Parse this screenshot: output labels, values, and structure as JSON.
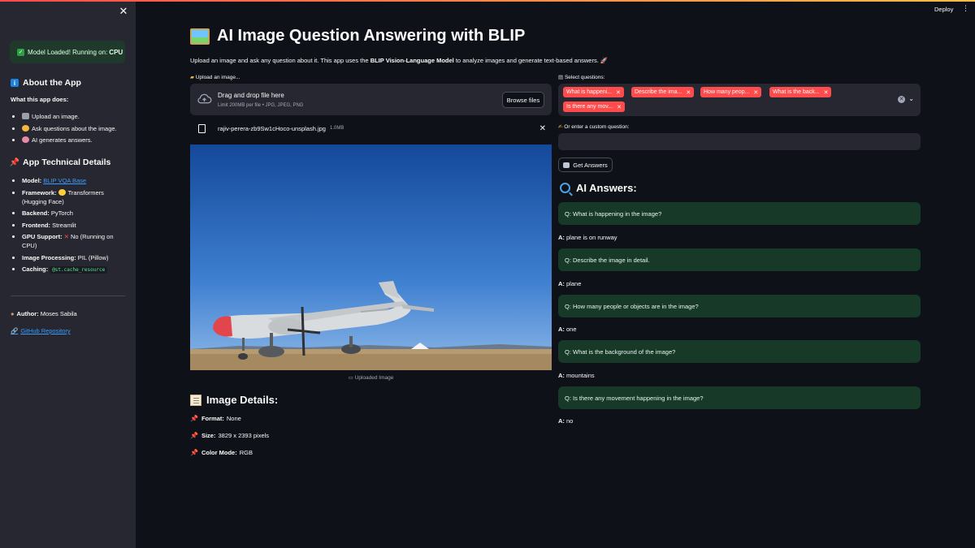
{
  "header": {
    "deploy_label": "Deploy",
    "menu_icon": "more-vert-icon"
  },
  "sidebar": {
    "close_icon": "close-icon",
    "status_pre": "Model Loaded! Running on: ",
    "status_device": "CPU",
    "about_title": "About the App",
    "about_subtitle": "What this app does:",
    "about_items": [
      {
        "text": "Upload an image.",
        "emoji_color": "#9aa0aa"
      },
      {
        "text": "Ask questions about the image.",
        "emoji_color": "#f5b73b"
      },
      {
        "text": "AI generates answers.",
        "emoji_color": "#e58aa8"
      }
    ],
    "tech_title": "App Technical Details",
    "tech_items": {
      "model_label": "Model:",
      "model_value": "BLIP VQA Base",
      "framework_label": "Framework:",
      "framework_value": "Transformers (Hugging Face)",
      "backend_label": "Backend:",
      "backend_value": "PyTorch",
      "frontend_label": "Frontend:",
      "frontend_value": "Streamlit",
      "gpu_label": "GPU Support:",
      "gpu_value": "No (Running on CPU)",
      "imgproc_label": "Image Processing:",
      "imgproc_value": "PIL (Pillow)",
      "caching_label": "Caching:",
      "caching_value": "@st.cache_resource"
    },
    "author_label": "Author:",
    "author_name": "Moses Sabila",
    "repo_link": "GitHub Repository"
  },
  "main": {
    "title": "AI Image Question Answering with BLIP",
    "subtitle_pre": "Upload an image and ask any question about it. This app uses the ",
    "subtitle_bold": "BLIP Vision-Language Model",
    "subtitle_post": " to analyze images and generate text-based answers. 🚀",
    "upload_label": "Upload an image...",
    "drag_text": "Drag and drop file here",
    "limit_text": "Limit 200MB per file • JPG, JPEG, PNG",
    "browse_label": "Browse files",
    "file_name": "rajiv-perera-zb9Sw1cHoco-unsplash.jpg",
    "file_size": "1.0MB",
    "image_caption": "Uploaded Image",
    "details_title": "Image Details:",
    "details": {
      "format_label": "Format:",
      "format_value": "None",
      "size_label": "Size:",
      "size_value": "3829 x 2393 pixels",
      "mode_label": "Color Mode:",
      "mode_value": "RGB"
    }
  },
  "questions": {
    "select_label": "Select questions:",
    "chips": [
      "What is happeni...",
      "Describe the ima...",
      "How many peop...",
      "What is the back...",
      "Is there any mov..."
    ],
    "custom_label": "Or enter a custom question:",
    "custom_value": "",
    "get_answers_label": "Get Answers"
  },
  "answers": {
    "title": "AI Answers:",
    "items": [
      {
        "q": "Q: What is happening in the image?",
        "a_label": "A:",
        "a": "plane is on runway"
      },
      {
        "q": "Q: Describe the image in detail.",
        "a_label": "A:",
        "a": "plane"
      },
      {
        "q": "Q: How many people or objects are in the image?",
        "a_label": "A:",
        "a": "one"
      },
      {
        "q": "Q: What is the background of the image?",
        "a_label": "A:",
        "a": "mountains"
      },
      {
        "q": "Q: Is there any movement happening in the image?",
        "a_label": "A:",
        "a": "no"
      }
    ]
  },
  "colors": {
    "accent": "#ff4b4b",
    "success_bg": "#173928",
    "sidebar_bg": "#262730",
    "app_bg": "#0e1117",
    "link": "#3a9bff"
  }
}
